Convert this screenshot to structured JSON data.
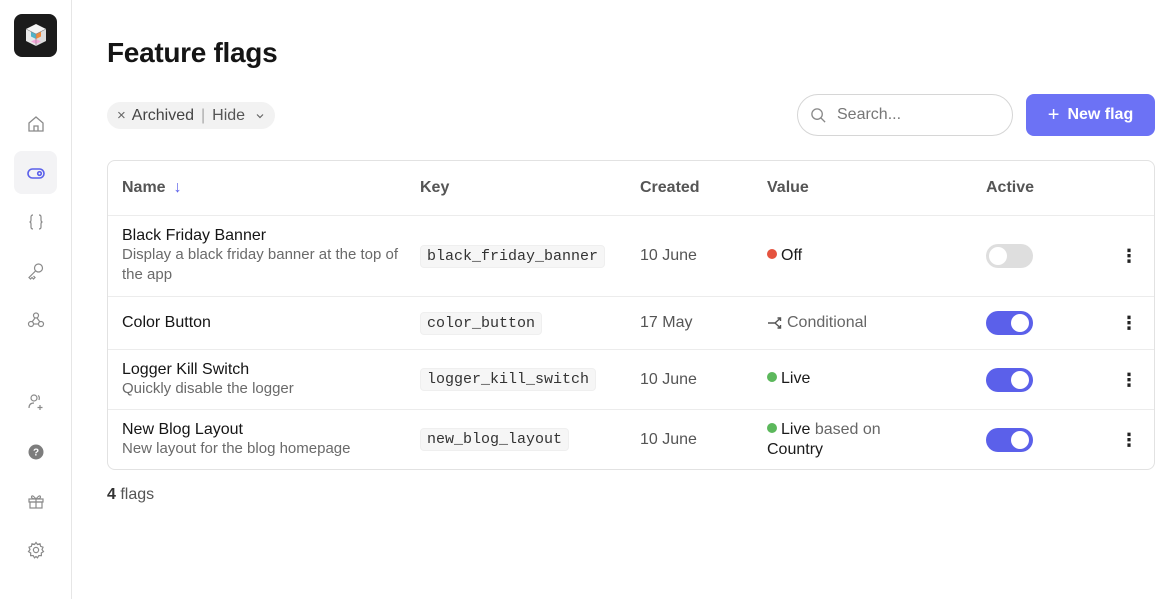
{
  "sidebar": {
    "logo": "app-logo",
    "items": [
      {
        "name": "home",
        "icon": "home-icon",
        "active": false
      },
      {
        "name": "feature-flags",
        "icon": "toggle-icon",
        "active": true
      },
      {
        "name": "configs",
        "icon": "braces-icon",
        "active": false
      },
      {
        "name": "keys",
        "icon": "key-icon",
        "active": false
      },
      {
        "name": "webhooks",
        "icon": "webhook-icon",
        "active": false
      },
      {
        "name": "invite-users",
        "icon": "user-plus-icon",
        "active": false
      },
      {
        "name": "help",
        "icon": "help-circle-icon",
        "active": false
      },
      {
        "name": "whats-new",
        "icon": "gift-icon",
        "active": false
      },
      {
        "name": "settings",
        "icon": "gear-icon",
        "active": false
      }
    ]
  },
  "page": {
    "title": "Feature flags"
  },
  "filter": {
    "label": "Archived",
    "value": "Hide",
    "separator": "|",
    "clear_glyph": "×"
  },
  "search": {
    "placeholder": "Search...",
    "value": ""
  },
  "new_flag_button": {
    "label": "New flag",
    "icon": "+"
  },
  "table": {
    "columns": [
      "Name",
      "Key",
      "Created",
      "Value",
      "Active"
    ],
    "sort_indicator": "↓",
    "rows": [
      {
        "name": "Black Friday Banner",
        "description": "Display a black friday banner at the top of the app",
        "key": "black_friday_banner",
        "created": "10 June",
        "value": {
          "type": "status",
          "dot_color": "#e5533f",
          "label": "Off",
          "suffix": "",
          "suffix_value": ""
        },
        "active": false
      },
      {
        "name": "Color Button",
        "description": "",
        "key": "color_button",
        "created": "17 May",
        "value": {
          "type": "conditional",
          "icon": "branch-icon",
          "label": "Conditional"
        },
        "active": true
      },
      {
        "name": "Logger Kill Switch",
        "description": "Quickly disable the logger",
        "key": "logger_kill_switch",
        "created": "10 June",
        "value": {
          "type": "status",
          "dot_color": "#5cb85c",
          "label": "Live",
          "suffix": "",
          "suffix_value": ""
        },
        "active": true
      },
      {
        "name": "New Blog Layout",
        "description": "New layout for the blog homepage",
        "key": "new_blog_layout",
        "created": "10 June",
        "value": {
          "type": "status",
          "dot_color": "#5cb85c",
          "label": "Live",
          "suffix": "based on",
          "suffix_value": "Country"
        },
        "active": true
      }
    ]
  },
  "footer": {
    "count": "4",
    "count_label": "flags"
  },
  "colors": {
    "accent": "#6c72f5",
    "toggle_on": "#5b60ea",
    "toggle_off": "#dedede",
    "off_dot": "#e5533f",
    "live_dot": "#5cb85c"
  }
}
